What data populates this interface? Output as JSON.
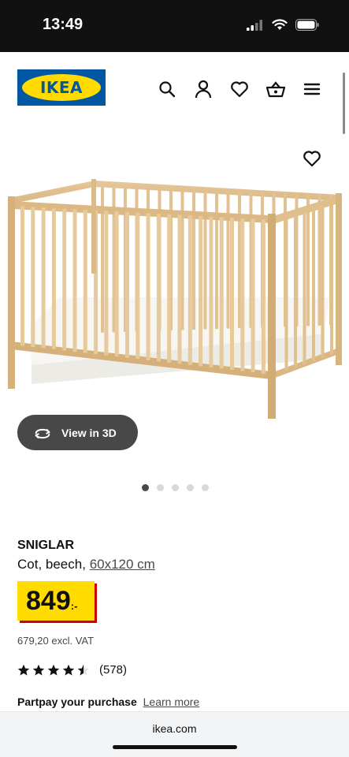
{
  "status_bar": {
    "time": "13:49"
  },
  "header": {
    "logo_text": "IKEA",
    "icons": [
      "search-icon",
      "profile-icon",
      "heart-icon",
      "basket-icon",
      "menu-icon"
    ]
  },
  "colors": {
    "ikea_blue": "#0058A3",
    "ikea_yellow": "#FFDB00",
    "price_shadow": "#CC0008",
    "dark_button": "#484848"
  },
  "gallery": {
    "view_3d_label": "View in 3D",
    "image_count": 5,
    "active_index": 0
  },
  "product": {
    "name": "SNIGLAR",
    "description": "Cot, beech,",
    "size": "60x120 cm",
    "price": "849",
    "price_suffix": ":-",
    "excl_vat": "679,20 excl. VAT",
    "rating": 4.5,
    "rating_max": 5,
    "review_count": "(578)"
  },
  "partpay": {
    "label": "Partpay your purchase",
    "link": "Learn more"
  },
  "browser": {
    "url": "ikea.com"
  }
}
